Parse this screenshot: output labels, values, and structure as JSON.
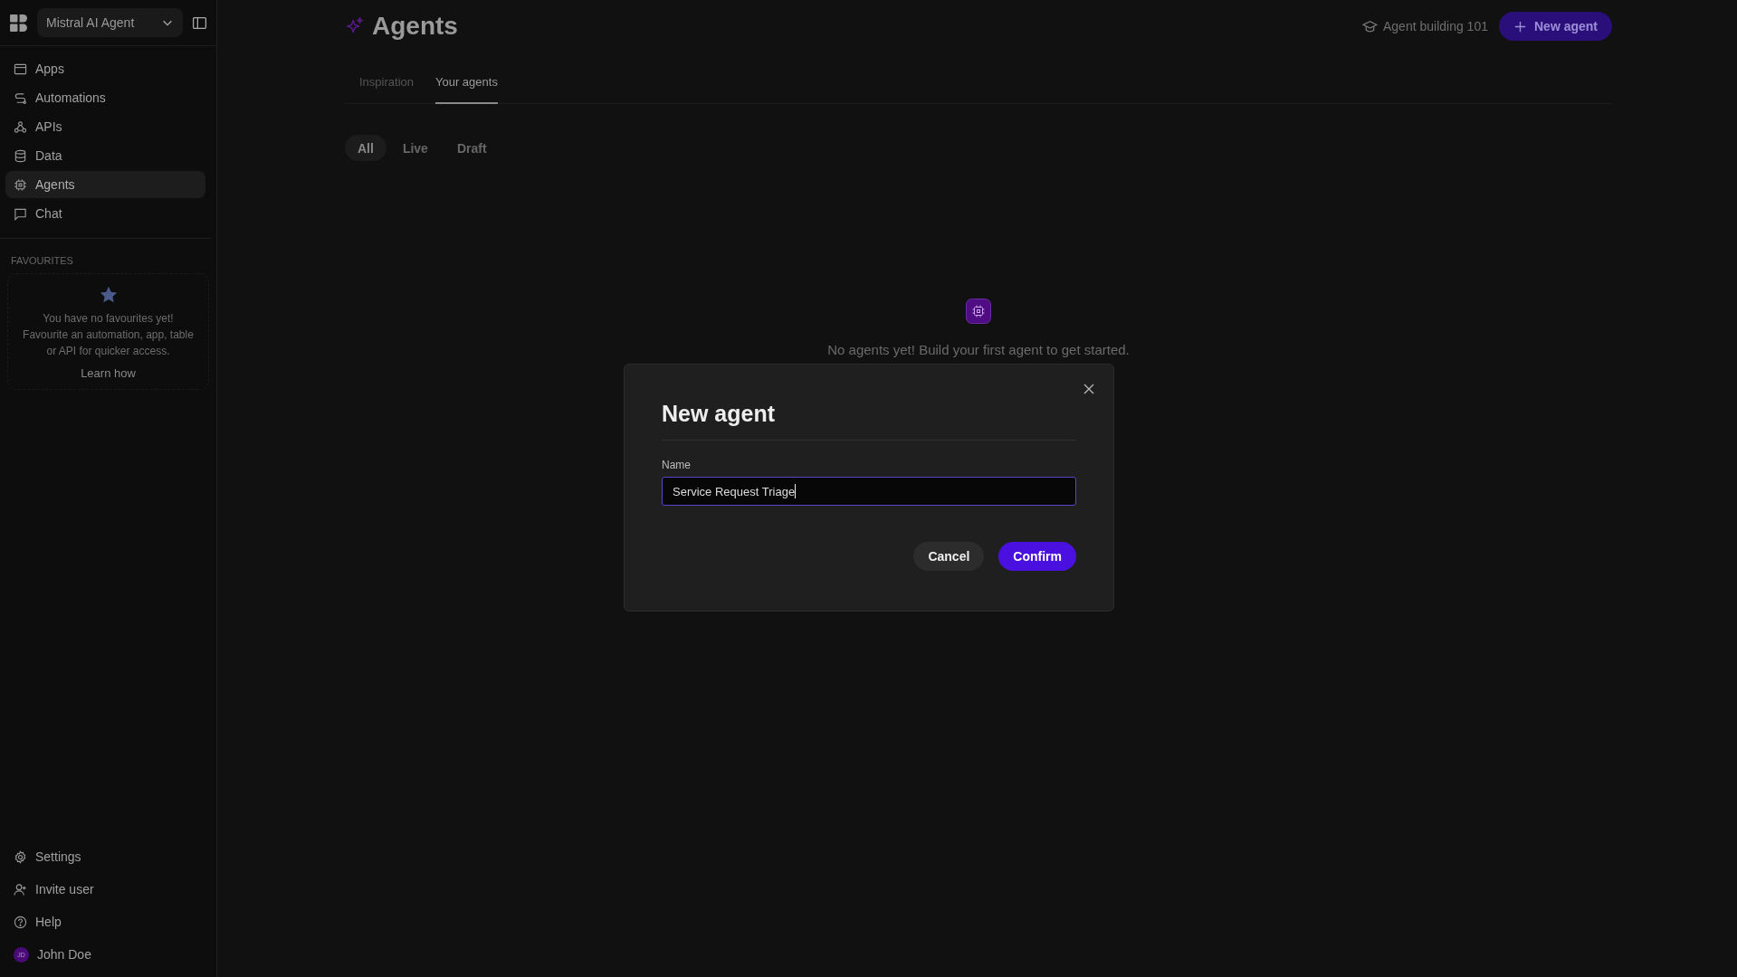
{
  "sidebar": {
    "workspace": "Mistral AI Agent",
    "nav": [
      {
        "label": "Apps",
        "selected": false
      },
      {
        "label": "Automations",
        "selected": false
      },
      {
        "label": "APIs",
        "selected": false
      },
      {
        "label": "Data",
        "selected": false
      },
      {
        "label": "Agents",
        "selected": true
      },
      {
        "label": "Chat",
        "selected": false
      }
    ],
    "favourites": {
      "heading": "FAVOURITES",
      "message": "You have no favourites yet! Favourite an automation, app, table or API for quicker access.",
      "link": "Learn how"
    },
    "bottom": [
      {
        "label": "Settings",
        "kind": "settings"
      },
      {
        "label": "Invite user",
        "kind": "invite"
      },
      {
        "label": "Help",
        "kind": "help"
      },
      {
        "label": "John Doe",
        "kind": "user",
        "initials": "JD"
      }
    ]
  },
  "header": {
    "title": "Agents",
    "guide_link": "Agent building 101",
    "new_button": "New agent"
  },
  "tabs": [
    {
      "label": "Inspiration",
      "selected": false
    },
    {
      "label": "Your agents",
      "selected": true
    }
  ],
  "filters": [
    {
      "label": "All",
      "selected": true
    },
    {
      "label": "Live",
      "selected": false
    },
    {
      "label": "Draft",
      "selected": false
    }
  ],
  "empty_state": {
    "message": "No agents yet! Build your first agent to get started."
  },
  "dialog": {
    "title": "New agent",
    "field_label": "Name",
    "value": "Service Request Triage",
    "buttons": [
      {
        "label": "Cancel",
        "kind": "secondary"
      },
      {
        "label": "Confirm",
        "kind": "primary"
      }
    ]
  }
}
